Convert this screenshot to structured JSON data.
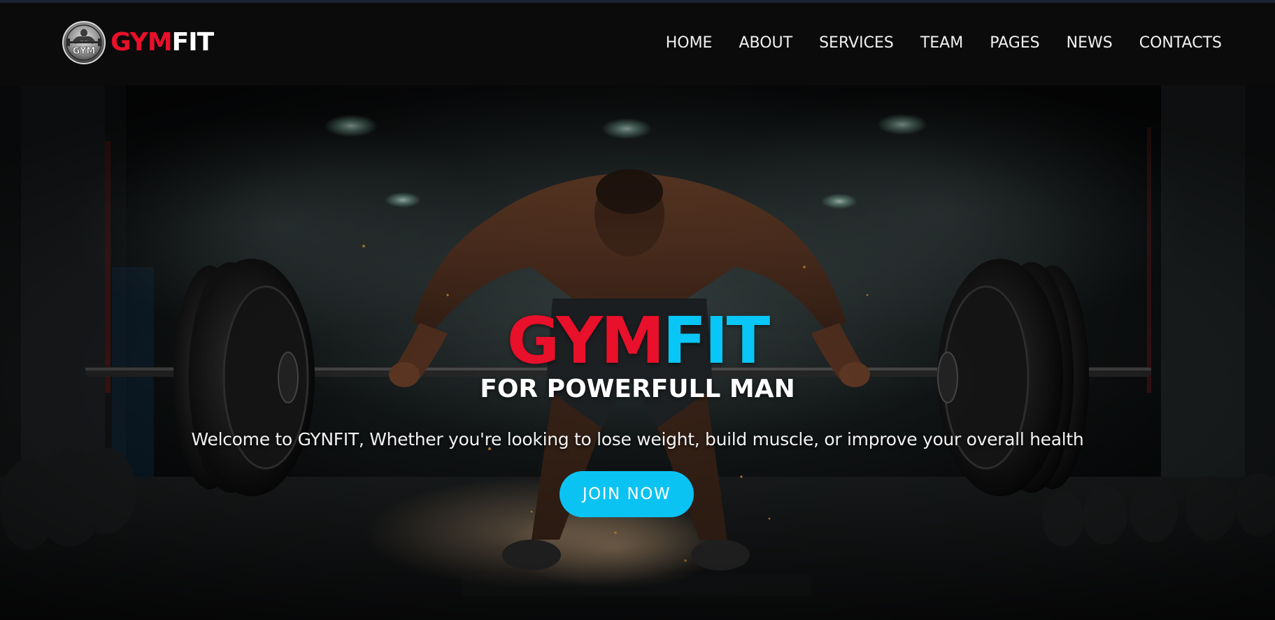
{
  "brand": {
    "logo_part1": "GYM",
    "logo_part2": "FIT",
    "badge_text": "GYM",
    "colors": {
      "red": "#e8102a",
      "cyan": "#08c6f5",
      "white": "#ffffff",
      "header_bg": "#0b0b0c"
    }
  },
  "nav": {
    "items": [
      {
        "label": "HOME"
      },
      {
        "label": "ABOUT"
      },
      {
        "label": "SERVICES"
      },
      {
        "label": "TEAM"
      },
      {
        "label": "PAGES"
      },
      {
        "label": "NEWS"
      },
      {
        "label": "CONTACTS"
      }
    ]
  },
  "hero": {
    "title_part1": "GYM",
    "title_part2": "FIT",
    "subtitle": "FOR POWERFULL MAN",
    "welcome": "Welcome to GYNFIT, Whether you're looking to lose weight, build muscle, or improve your overall health",
    "cta_label": "JOIN NOW",
    "background_icon": "weightlifter-deadlift-image"
  }
}
